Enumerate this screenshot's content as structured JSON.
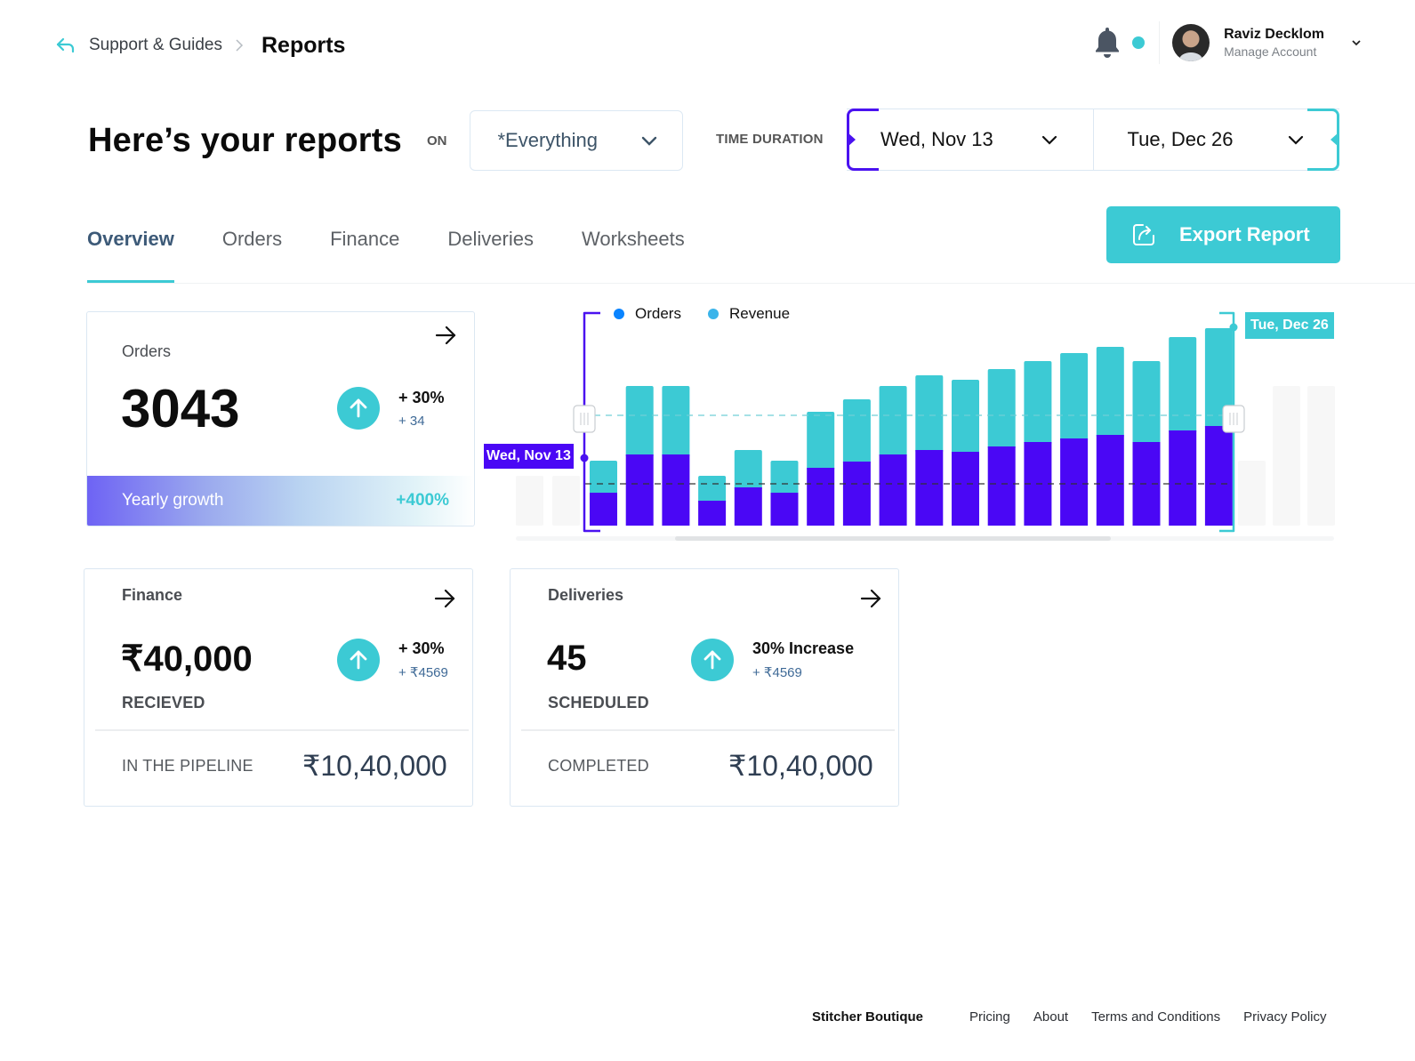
{
  "header": {
    "breadcrumb_parent": "Support & Guides",
    "breadcrumb_current": "Reports",
    "notification_dot_color": "#3ccad4",
    "user_name": "Raviz Decklom",
    "user_subtitle": "Manage Account"
  },
  "filters": {
    "title": "Here’s your reports",
    "on_label": "ON",
    "scope_value": "*Everything",
    "time_label": "TIME DURATION",
    "start_date": "Wed, Nov 13",
    "end_date": "Tue, Dec 26"
  },
  "tabs": [
    {
      "label": "Overview",
      "active": true
    },
    {
      "label": "Orders",
      "active": false
    },
    {
      "label": "Finance",
      "active": false
    },
    {
      "label": "Deliveries",
      "active": false
    },
    {
      "label": "Worksheets",
      "active": false
    }
  ],
  "export_label": "Export Report",
  "orders_card": {
    "label": "Orders",
    "value": "3043",
    "delta_pct": "+ 30%",
    "delta_abs": "+ 34",
    "growth_label": "Yearly growth",
    "growth_value": "+400%"
  },
  "finance_card": {
    "label": "Finance",
    "value": "₹40,000",
    "value_label": "RECIEVED",
    "delta_pct": "+ 30%",
    "delta_abs": "+ ₹4569",
    "bottom_label": "IN THE PIPELINE",
    "bottom_value": "₹10,40,000"
  },
  "deliveries_card": {
    "label": "Deliveries",
    "value": "45",
    "value_label": "SCHEDULED",
    "delta_pct": "30% Increase",
    "delta_abs": "+ ₹4569",
    "bottom_label": "COMPLETED",
    "bottom_value": "₹10,40,000"
  },
  "colors": {
    "accent": "#3ccad4",
    "primary": "#4a07f5",
    "orders_legend": "#0a84ff",
    "revenue_legend": "#3bb4ea"
  },
  "chart_data": {
    "type": "bar",
    "stacked": true,
    "legend": [
      "Orders",
      "Revenue"
    ],
    "range_start_label": "Wed, Nov 13",
    "range_end_label": "Tue, Dec 26",
    "series": [
      {
        "name": "Orders",
        "color": "#4a07f5",
        "values": [
          37,
          80,
          80,
          28,
          43,
          37,
          65,
          72,
          80,
          85,
          83,
          89,
          94,
          98,
          102,
          94,
          107,
          112
        ]
      },
      {
        "name": "Revenue",
        "color": "#3ccad4",
        "values": [
          36,
          77,
          77,
          28,
          42,
          36,
          63,
          70,
          77,
          84,
          81,
          87,
          91,
          96,
          99,
          91,
          105,
          110
        ]
      }
    ],
    "ghost_before": [
      56,
      56
    ],
    "ghost_after": [
      73,
      157,
      157
    ],
    "reference_lines": [
      124,
      47
    ],
    "ylim": [
      0,
      230
    ],
    "grid": false
  },
  "footer": {
    "brand": "Stitcher Boutique",
    "links": [
      "Pricing",
      "About",
      "Terms and Conditions",
      "Privacy Policy"
    ]
  }
}
